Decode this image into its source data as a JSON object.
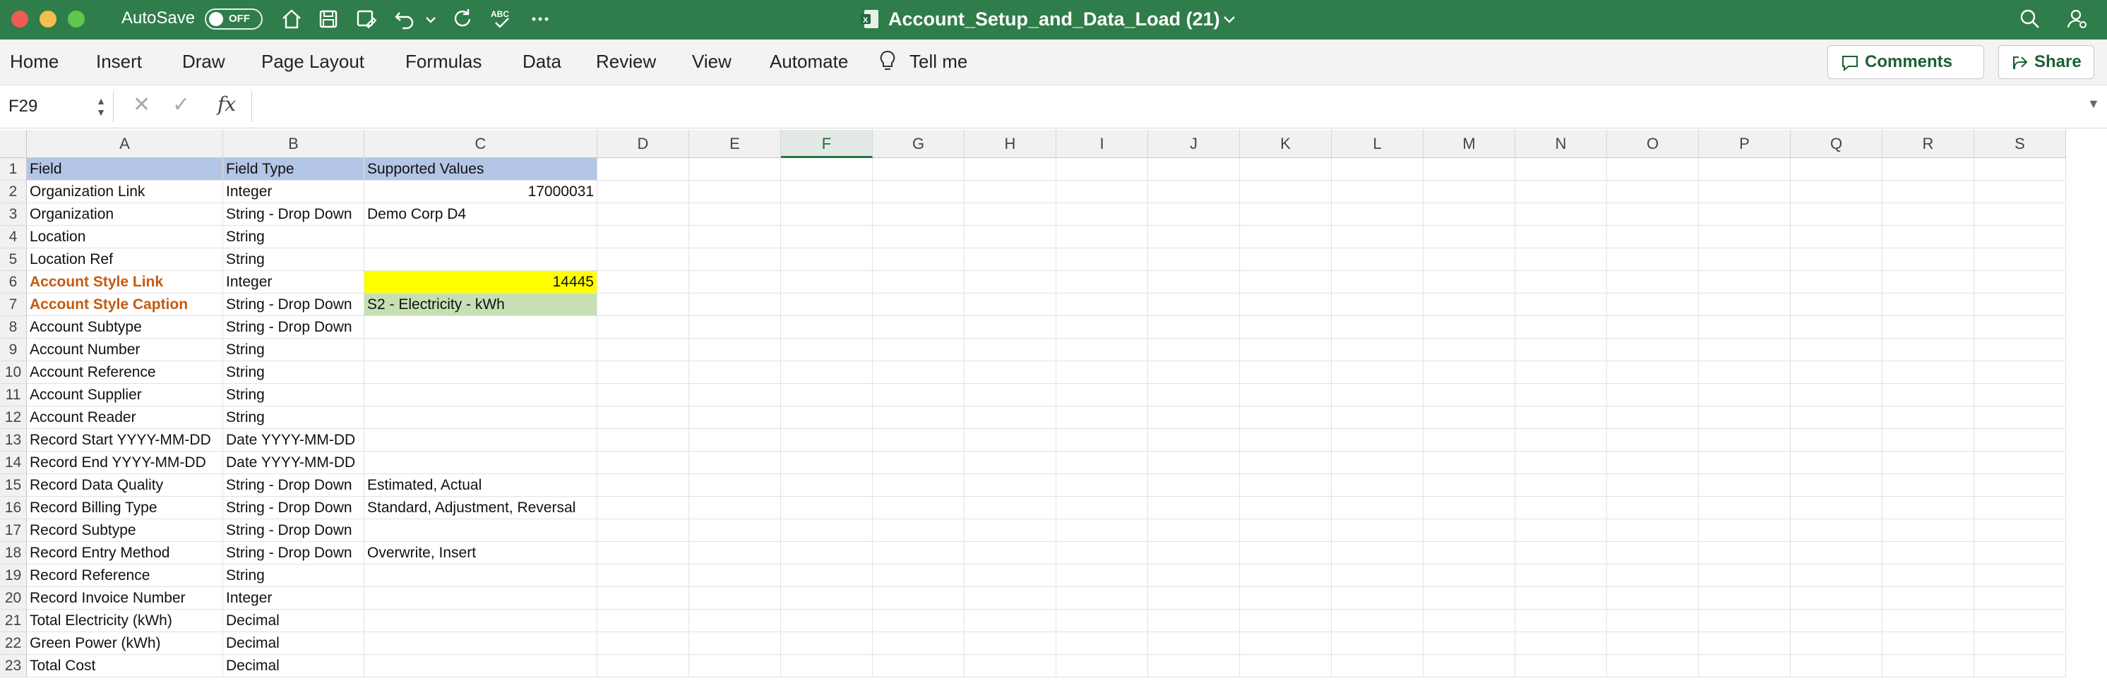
{
  "titlebar": {
    "autosave_label": "AutoSave",
    "autosave_state": "OFF",
    "doc_title": "Account_Setup_and_Data_Load (21)",
    "icons": [
      "home-icon",
      "save-icon",
      "save-as-icon",
      "undo-icon",
      "redo-icon",
      "spelling-icon",
      "more-icon",
      "search-icon",
      "account-icon"
    ]
  },
  "ribbon": {
    "tabs": [
      "Home",
      "Insert",
      "Draw",
      "Page Layout",
      "Formulas",
      "Data",
      "Review",
      "View",
      "Automate",
      "Tell me"
    ],
    "comments_label": "Comments",
    "share_label": "Share"
  },
  "formula_bar": {
    "name_box": "F29",
    "fx_label": "fx",
    "formula": ""
  },
  "sheet": {
    "columns": [
      "A",
      "B",
      "C",
      "D",
      "E",
      "F",
      "G",
      "H",
      "I",
      "J",
      "K",
      "L",
      "M",
      "N",
      "O",
      "P",
      "Q",
      "R",
      "S"
    ],
    "selected_column": "F",
    "rows": [
      {
        "n": "1",
        "a": "Field",
        "b": "Field Type",
        "c": "Supported Values"
      },
      {
        "n": "2",
        "a": "Organization Link",
        "b": "Integer",
        "c": "17000031"
      },
      {
        "n": "3",
        "a": "Organization",
        "b": "String - Drop Down",
        "c": "Demo Corp D4"
      },
      {
        "n": "4",
        "a": "Location",
        "b": "String",
        "c": ""
      },
      {
        "n": "5",
        "a": "Location Ref",
        "b": "String",
        "c": ""
      },
      {
        "n": "6",
        "a": "Account Style Link",
        "b": "Integer",
        "c": "14445"
      },
      {
        "n": "7",
        "a": "Account Style Caption",
        "b": "String - Drop Down",
        "c": "S2 - Electricity - kWh"
      },
      {
        "n": "8",
        "a": "Account Subtype",
        "b": "String - Drop Down",
        "c": ""
      },
      {
        "n": "9",
        "a": "Account Number",
        "b": "String",
        "c": ""
      },
      {
        "n": "10",
        "a": "Account Reference",
        "b": "String",
        "c": ""
      },
      {
        "n": "11",
        "a": "Account Supplier",
        "b": "String",
        "c": ""
      },
      {
        "n": "12",
        "a": "Account Reader",
        "b": "String",
        "c": ""
      },
      {
        "n": "13",
        "a": "Record Start YYYY-MM-DD",
        "b": "Date YYYY-MM-DD",
        "c": ""
      },
      {
        "n": "14",
        "a": "Record End YYYY-MM-DD",
        "b": "Date YYYY-MM-DD",
        "c": ""
      },
      {
        "n": "15",
        "a": "Record Data Quality",
        "b": "String - Drop Down",
        "c": "Estimated, Actual"
      },
      {
        "n": "16",
        "a": "Record Billing Type",
        "b": "String - Drop Down",
        "c": "Standard, Adjustment, Reversal"
      },
      {
        "n": "17",
        "a": "Record Subtype",
        "b": "String - Drop Down",
        "c": ""
      },
      {
        "n": "18",
        "a": "Record Entry Method",
        "b": "String - Drop Down",
        "c": "Overwrite, Insert"
      },
      {
        "n": "19",
        "a": "Record Reference",
        "b": "String",
        "c": ""
      },
      {
        "n": "20",
        "a": "Record Invoice Number",
        "b": "Integer",
        "c": ""
      },
      {
        "n": "21",
        "a": "Total Electricity (kWh)",
        "b": "Decimal",
        "c": ""
      },
      {
        "n": "22",
        "a": "Green Power (kWh)",
        "b": "Decimal",
        "c": ""
      },
      {
        "n": "23",
        "a": "Total Cost",
        "b": "Decimal",
        "c": ""
      }
    ]
  },
  "colors": {
    "titlebar": "#2f7d4a",
    "header_fill": "#b4c6e7",
    "orange_text": "#c55a11",
    "yellow_fill": "#ffff00",
    "green_fill": "#c6e0b4"
  }
}
